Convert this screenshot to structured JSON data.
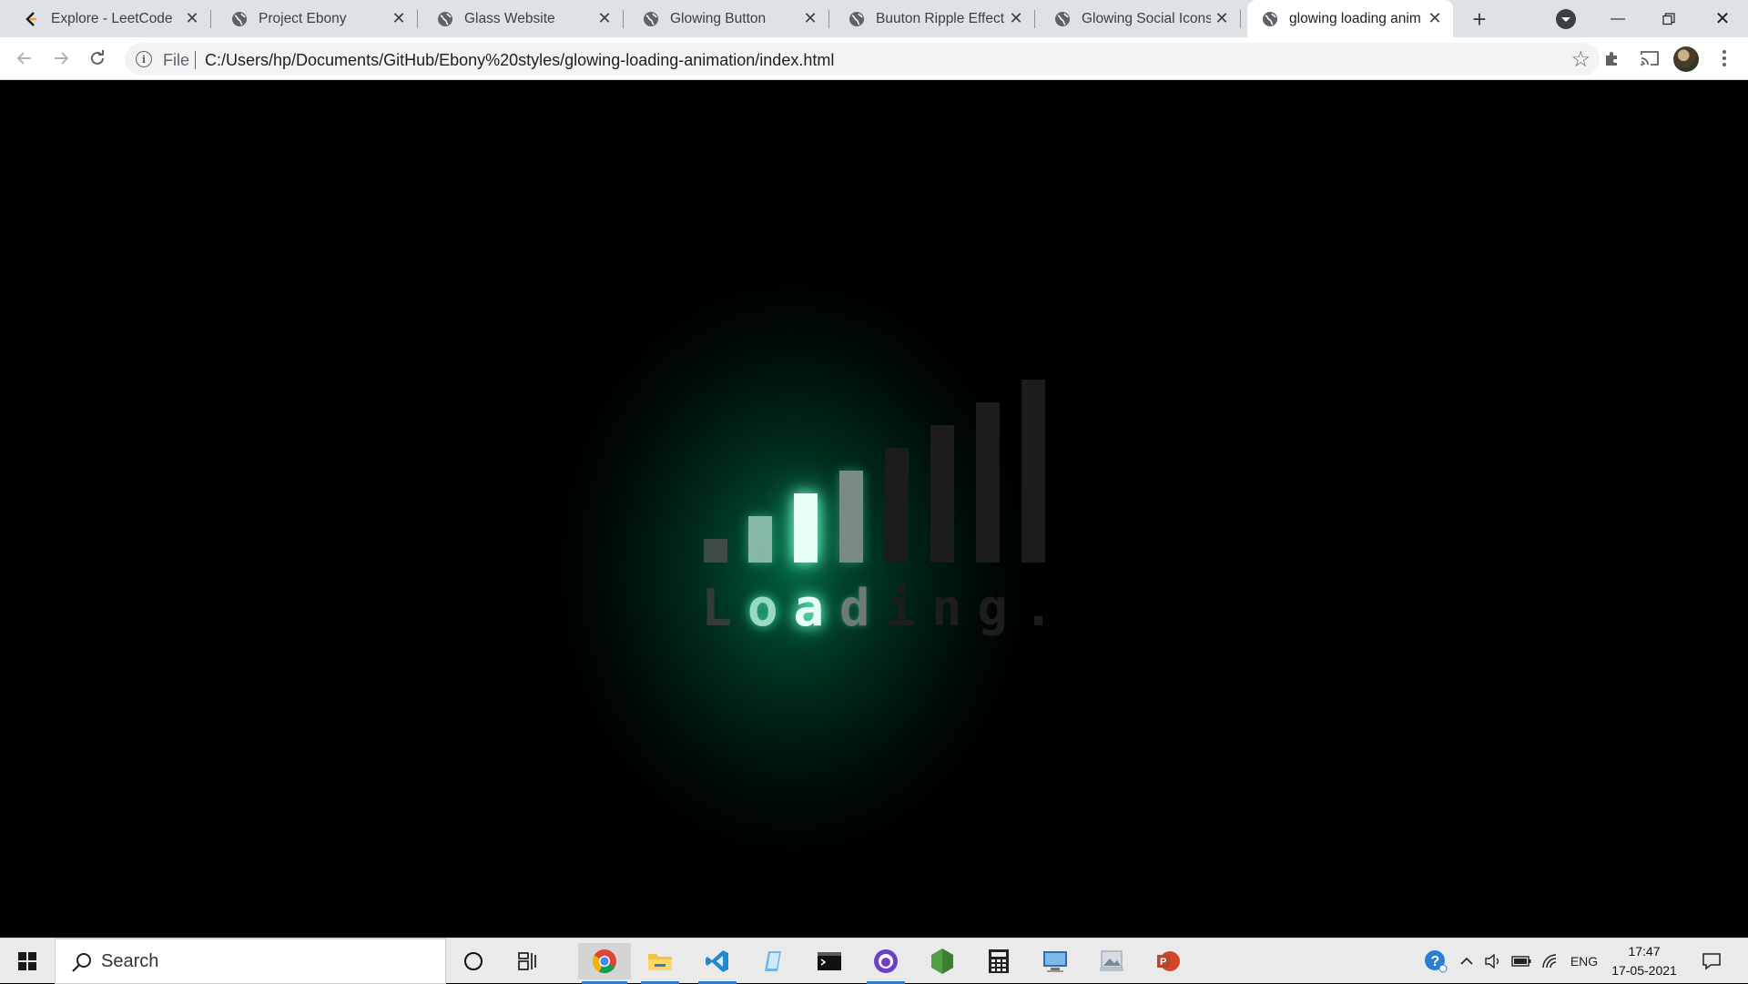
{
  "browser": {
    "tabs": [
      {
        "title": "Explore - LeetCode",
        "favicon": "leetcode-icon"
      },
      {
        "title": "Project Ebony",
        "favicon": "globe-icon"
      },
      {
        "title": "Glass Website",
        "favicon": "globe-icon"
      },
      {
        "title": "Glowing Button",
        "favicon": "globe-icon"
      },
      {
        "title": "Buuton Ripple Effect",
        "favicon": "globe-icon"
      },
      {
        "title": "Glowing Social Icons",
        "favicon": "globe-icon"
      },
      {
        "title": "glowing loading anim",
        "favicon": "globe-icon",
        "active": true
      }
    ],
    "address_bar": {
      "scheme_label": "File",
      "url": "C:/Users/hp/Documents/GitHub/Ebony%20styles/glowing-loading-animation/index.html"
    }
  },
  "page": {
    "loading_letters": [
      "L",
      "o",
      "a",
      "d",
      "i",
      "n",
      "g",
      "."
    ],
    "accent_color": "#3dffb0",
    "background_color": "#000000"
  },
  "taskbar": {
    "search_placeholder": "Search",
    "language": "ENG",
    "time": "17:47",
    "date": "17-05-2021"
  }
}
